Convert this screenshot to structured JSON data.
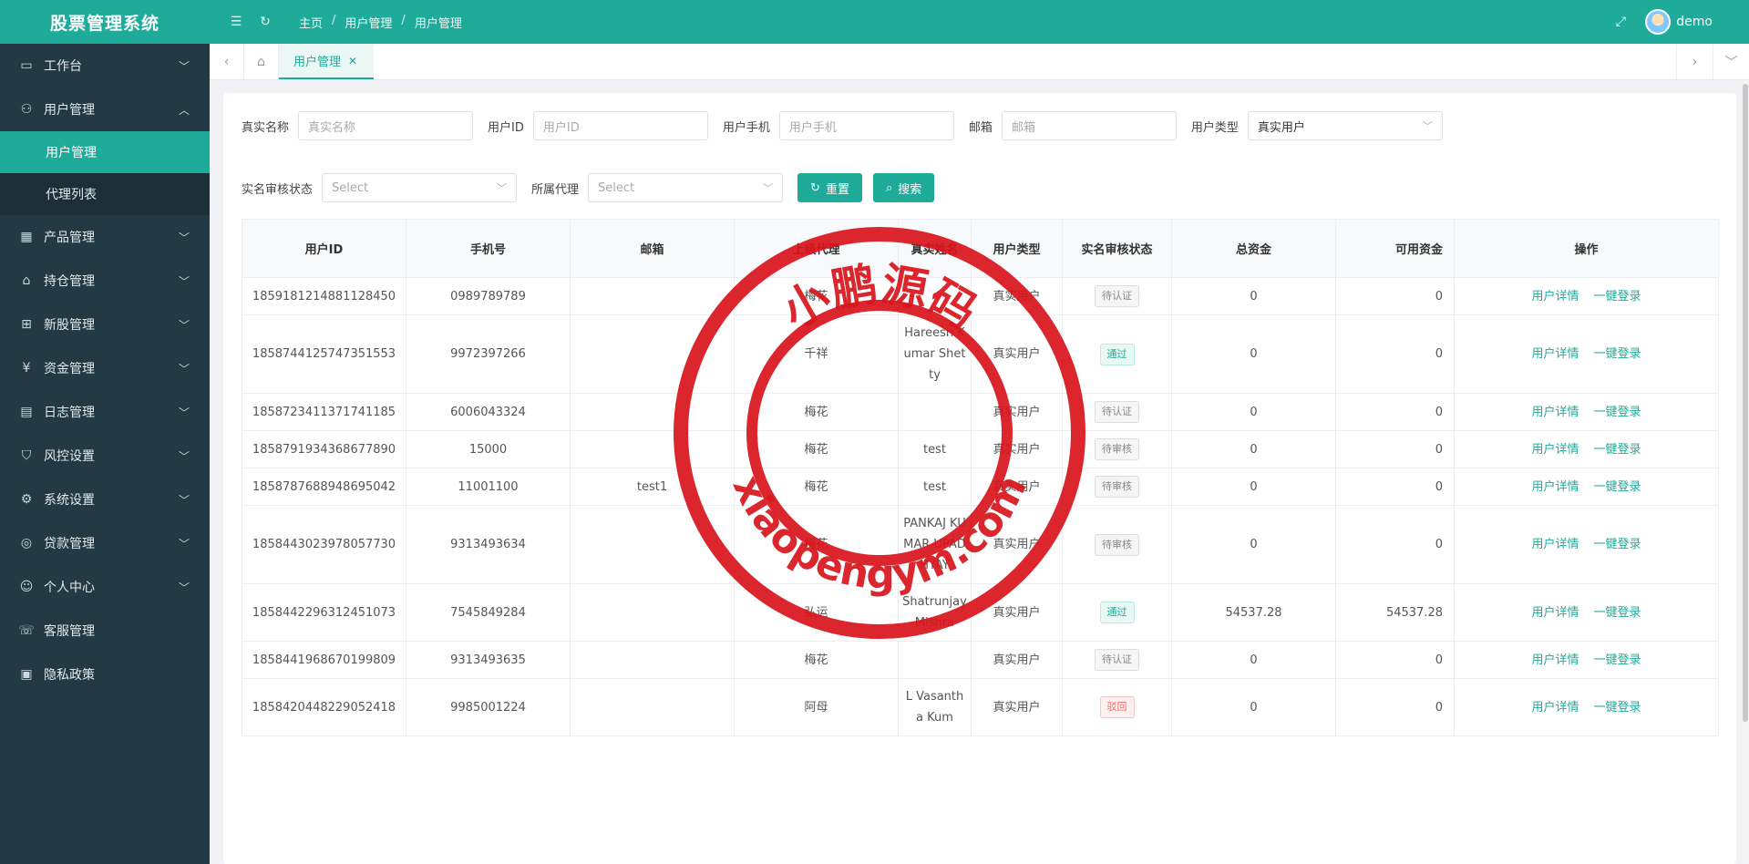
{
  "app": {
    "title": "股票管理系统"
  },
  "header": {
    "breadcrumb": [
      "主页",
      "用户管理",
      "用户管理"
    ],
    "breadcrumb_sep": "/",
    "user": "demo",
    "icons": [
      "menu-fold-icon",
      "refresh-icon",
      "fullscreen-icon",
      "avatar"
    ]
  },
  "sidebar": {
    "items": [
      {
        "label": "工作台",
        "icon": "monitor-icon",
        "expanded": false
      },
      {
        "label": "用户管理",
        "icon": "user-icon",
        "expanded": true,
        "children": [
          {
            "label": "用户管理",
            "active": true
          },
          {
            "label": "代理列表",
            "active": false
          }
        ]
      },
      {
        "label": "产品管理",
        "icon": "grid-icon",
        "expanded": false
      },
      {
        "label": "持仓管理",
        "icon": "home-icon",
        "expanded": false
      },
      {
        "label": "新股管理",
        "icon": "chart-icon",
        "expanded": false
      },
      {
        "label": "资金管理",
        "icon": "money-icon",
        "expanded": false
      },
      {
        "label": "日志管理",
        "icon": "document-icon",
        "expanded": false
      },
      {
        "label": "风控设置",
        "icon": "shield-icon",
        "expanded": false
      },
      {
        "label": "系统设置",
        "icon": "settings-icon",
        "expanded": false
      },
      {
        "label": "贷款管理",
        "icon": "loan-icon",
        "expanded": false
      },
      {
        "label": "个人中心",
        "icon": "profile-icon",
        "expanded": false
      },
      {
        "label": "客服管理",
        "icon": "service-icon"
      },
      {
        "label": "隐私政策",
        "icon": "privacy-icon"
      }
    ]
  },
  "tabs": {
    "active": "用户管理",
    "close": "✕"
  },
  "filters": {
    "real_name": {
      "label": "真实名称",
      "placeholder": "真实名称"
    },
    "user_id": {
      "label": "用户ID",
      "placeholder": "用户ID"
    },
    "phone": {
      "label": "用户手机",
      "placeholder": "用户手机"
    },
    "email": {
      "label": "邮箱",
      "placeholder": "邮箱"
    },
    "user_type": {
      "label": "用户类型",
      "value": "真实用户"
    },
    "verify_status": {
      "label": "实名审核状态",
      "placeholder": "Select"
    },
    "agent": {
      "label": "所属代理",
      "placeholder": "Select"
    },
    "reset_label": "重置",
    "search_label": "搜索"
  },
  "table": {
    "columns": [
      "用户ID",
      "手机号",
      "邮箱",
      "上级代理",
      "真实姓名",
      "用户类型",
      "实名审核状态",
      "总资金",
      "可用资金",
      "操作"
    ],
    "actions": [
      "用户详情",
      "一键登录"
    ],
    "rows": [
      {
        "id": "1859181214881128450",
        "phone": "0989789789",
        "email": "",
        "agent": "梅花",
        "name": "",
        "type": "真实用户",
        "status": "待认证",
        "status_kind": "pending",
        "total": "0",
        "available": "0"
      },
      {
        "id": "1858744125747351553",
        "phone": "9972397266",
        "email": "",
        "agent": "千祥",
        "name": "Hareesh Kumar Shetty",
        "type": "真实用户",
        "status": "通过",
        "status_kind": "pass",
        "total": "0",
        "available": "0"
      },
      {
        "id": "1858723411371741185",
        "phone": "6006043324",
        "email": "",
        "agent": "梅花",
        "name": "",
        "type": "真实用户",
        "status": "待认证",
        "status_kind": "pending",
        "total": "0",
        "available": "0"
      },
      {
        "id": "1858791934368677890",
        "phone": "15000",
        "email": "",
        "agent": "梅花",
        "name": "test",
        "type": "真实用户",
        "status": "待审核",
        "status_kind": "pending",
        "total": "0",
        "available": "0"
      },
      {
        "id": "1858787688948695042",
        "phone": "11001100",
        "email": "test1",
        "agent": "梅花",
        "name": "test",
        "type": "真实用户",
        "status": "待审核",
        "status_kind": "pending",
        "total": "0",
        "available": "0"
      },
      {
        "id": "1858443023978057730",
        "phone": "9313493634",
        "email": "",
        "agent": "梅花",
        "name": "PANKAJ KUMAR UPADHYAY",
        "type": "真实用户",
        "status": "待审核",
        "status_kind": "pending",
        "total": "0",
        "available": "0"
      },
      {
        "id": "1858442296312451073",
        "phone": "7545849284",
        "email": "",
        "agent": "弘运",
        "name": "Shatrunjay Mishra",
        "type": "真实用户",
        "status": "通过",
        "status_kind": "pass",
        "total": "54537.28",
        "available": "54537.28"
      },
      {
        "id": "1858441968670199809",
        "phone": "9313493635",
        "email": "",
        "agent": "梅花",
        "name": "",
        "type": "真实用户",
        "status": "待认证",
        "status_kind": "pending",
        "total": "0",
        "available": "0"
      },
      {
        "id": "1858420448229052418",
        "phone": "9985001224",
        "email": "",
        "agent": "阿母",
        "name": "L Vasantha Kum",
        "type": "真实用户",
        "status": "驳回",
        "status_kind": "reject",
        "total": "0",
        "available": "0"
      }
    ]
  },
  "watermark": {
    "top_text": "小鹏源码",
    "bottom_text": "xiaopengym.com",
    "color": "#d9141c"
  },
  "colors": {
    "accent": "#1fab9a",
    "sidebar": "#233a44"
  }
}
